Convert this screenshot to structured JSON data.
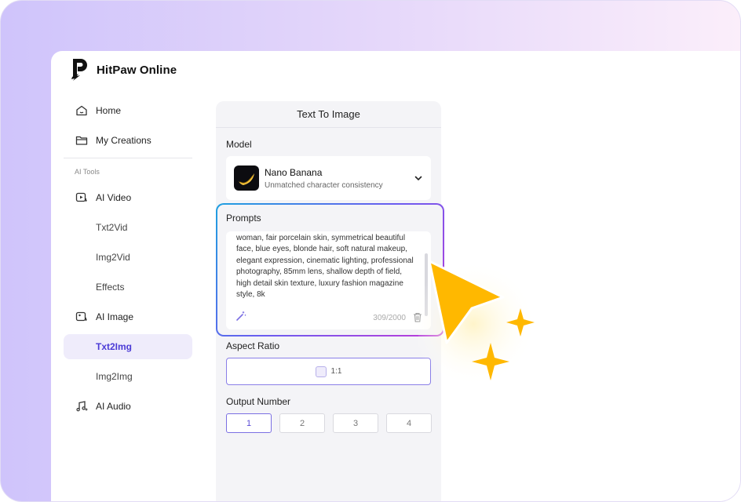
{
  "app": {
    "title": "HitPaw Online"
  },
  "sidebar": {
    "items": [
      {
        "label": "Home",
        "icon": "home-icon"
      },
      {
        "label": "My Creations",
        "icon": "folder-icon"
      }
    ],
    "section_label": "AI Tools",
    "tools": [
      {
        "label": "AI Video",
        "icon": "video-icon"
      },
      {
        "label": "Txt2Vid"
      },
      {
        "label": "Img2Vid"
      },
      {
        "label": "Effects"
      },
      {
        "label": "AI Image",
        "icon": "image-icon"
      },
      {
        "label": "Txt2Img",
        "active": true
      },
      {
        "label": "Img2Img"
      },
      {
        "label": "AI Audio",
        "icon": "music-icon"
      }
    ]
  },
  "panel": {
    "title": "Text To Image",
    "model_label": "Model",
    "model": {
      "name": "Nano Banana",
      "description": "Unmatched character consistency"
    },
    "prompts_label": "Prompts",
    "prompt_text": "woman, fair porcelain skin, symmetrical beautiful face, blue eyes, blonde hair, soft natural makeup, elegant expression, cinematic lighting, professional photography, 85mm lens, shallow depth of field, high detail skin texture, luxury fashion magazine style, 8k",
    "prompt_counter": "309/2000",
    "aspect_label": "Aspect Ratio",
    "aspect_value": "1:1",
    "output_label": "Output Number",
    "output_options": [
      "1",
      "2",
      "3",
      "4"
    ],
    "output_selected": "1"
  },
  "colors": {
    "accent": "#4b3bd6",
    "cursor": "#FFB800",
    "frame_gradient": [
      "#cfc4fb",
      "#fbeefa"
    ]
  }
}
